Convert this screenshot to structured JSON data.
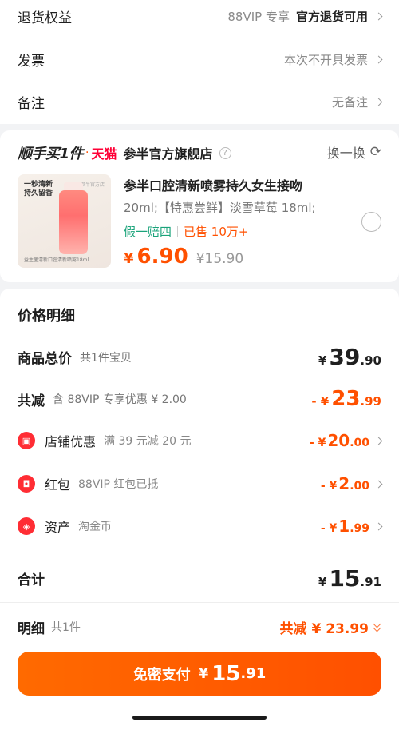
{
  "settings": [
    {
      "label": "退货权益",
      "value": "88VIP 专享",
      "value_bold": "官方退货可用"
    },
    {
      "label": "发票",
      "value": "本次不开具发票"
    },
    {
      "label": "备注",
      "value": "无备注"
    }
  ],
  "store": {
    "logo_text": "顺手买1件",
    "dot": "·",
    "tmall": "天猫",
    "name": "参半官方旗舰店",
    "help": "?",
    "swap": "换一换"
  },
  "product": {
    "thumb_text": "一秒清新 持久留香",
    "thumb_brand": "参半官方店",
    "thumb_foot": "益生菌清新口腔清新喷雾18ml",
    "title": "参半口腔清新喷雾持久女生接吻",
    "spec": "20ml;【特惠尝鲜】淡雪草莓 18ml;",
    "guarantee": "假一赔四",
    "sold": "已售 10万+",
    "currency": "¥",
    "price": "6.90",
    "original": "¥15.90"
  },
  "detail": {
    "title": "价格明细",
    "total": {
      "label": "商品总价",
      "sub": "共1件宝贝",
      "currency": "¥",
      "int": "39",
      "dec": ".90"
    },
    "reduce": {
      "label": "共减",
      "sub": "含 88VIP 专享优惠 ¥ 2.00",
      "prefix": "- ¥",
      "int": "23",
      "dec": ".99"
    },
    "items": [
      {
        "icon": "store-coupon-icon",
        "label": "店铺优惠",
        "sub": "满 39 元减 20 元",
        "prefix": "- ¥",
        "int": "20",
        "dec": ".00"
      },
      {
        "icon": "red-packet-icon",
        "label": "红包",
        "sub": "88VIP 红包已抵",
        "prefix": "- ¥",
        "int": "2",
        "dec": ".00"
      },
      {
        "icon": "asset-tag-icon",
        "label": "资产",
        "sub": "淘金币",
        "prefix": "- ¥",
        "int": "1",
        "dec": ".99"
      }
    ],
    "sum": {
      "label": "合计",
      "currency": "¥",
      "int": "15",
      "dec": ".91"
    }
  },
  "bottom": {
    "label": "明细",
    "count": "共1件",
    "reduce": "共减 ¥ 23.99",
    "pay_label": "免密支付",
    "currency": "¥",
    "int": "15",
    "dec": ".91"
  },
  "colors": {
    "accent": "#ff5000",
    "tmall": "#ff0036",
    "green": "#1aa37a",
    "icon_red": "#ff2d34"
  }
}
